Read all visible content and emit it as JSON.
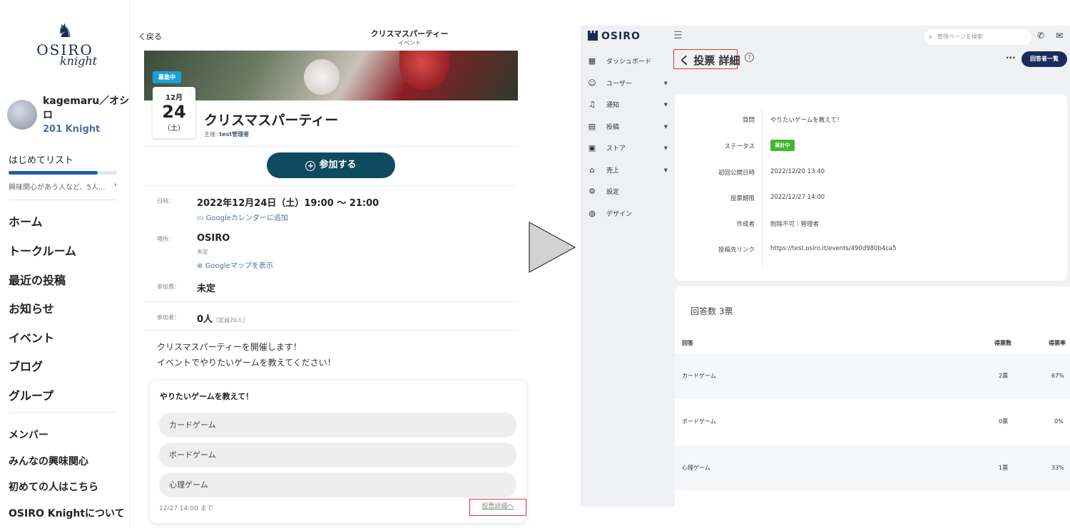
{
  "member_app": {
    "logo": {
      "main": "OSIRO",
      "sub": "knight"
    },
    "profile": {
      "name": "kagemaru／オシロ",
      "knight_level": "201 Knight"
    },
    "checklist": {
      "title": "はじめてリスト",
      "subtitle": "興味関心があう人など、5人...",
      "chevron": "›",
      "progress_percent": 82
    },
    "nav": [
      "ホーム",
      "トークルーム",
      "最近の投稿",
      "お知らせ",
      "イベント",
      "ブログ",
      "グループ"
    ],
    "sub_nav": [
      "メンバー",
      "みんなの興味関心",
      "初めての人はこちら",
      "OSIRO Knightについて"
    ],
    "event": {
      "back_label": "く戻る",
      "header_title": "クリスマスパーティー",
      "header_subtitle": "イベント",
      "recruiting_badge": "募集中",
      "date_month": "12月",
      "date_day": "24",
      "date_dow": "（土）",
      "title": "クリスマスパーティー",
      "host_label": "主催:",
      "host_name": "test管理者",
      "join_button": "参加する",
      "date_label": "日時：",
      "date_value": "2022年12月24日（土）19:00 ～ 21:00",
      "calendar_link": "Googleカレンダーに追加",
      "place_label": "場所：",
      "place_value": "OSIRO",
      "place_note": "未定",
      "map_link": "Googleマップを表示",
      "fee_label": "参加費：",
      "fee_value": "未定",
      "participants_label": "参加者：",
      "participants_value": "0人",
      "participants_capacity": "（定員20人）",
      "description_lines": [
        "クリスマスパーティーを開催します！",
        "イベントでやりたいゲームを教えてください！"
      ]
    },
    "poll": {
      "question": "やりたいゲームを教えて！",
      "options": [
        "カードゲーム",
        "ボードゲーム",
        "心理ゲーム"
      ],
      "deadline": "12/27 14:00 まで",
      "detail_link": "投票詳細へ"
    }
  },
  "admin_app": {
    "logo": "OSIRO",
    "search_placeholder": "管理ページを検索",
    "nav": [
      {
        "label": "ダッシュボード",
        "icon": "dashboard-icon",
        "glyph": "▦",
        "has_caret": false
      },
      {
        "label": "ユーザー",
        "icon": "user-face-icon",
        "glyph": "☺",
        "has_caret": true
      },
      {
        "label": "通知",
        "icon": "bell-icon",
        "glyph": "♫",
        "has_caret": true
      },
      {
        "label": "投稿",
        "icon": "document-icon",
        "glyph": "▤",
        "has_caret": true
      },
      {
        "label": "ストア",
        "icon": "store-icon",
        "glyph": "▣",
        "has_caret": true
      },
      {
        "label": "売上",
        "icon": "bank-icon",
        "glyph": "⌂",
        "has_caret": true
      },
      {
        "label": "設定",
        "icon": "gear-icon",
        "glyph": "⚙",
        "has_caret": false
      },
      {
        "label": "デザイン",
        "icon": "palette-icon",
        "glyph": "◍",
        "has_caret": false
      }
    ],
    "page_title": "く 投票 詳細",
    "respondents_button": "回答者一覧",
    "details": [
      {
        "label": "質問",
        "value": "やりたいゲームを教えて！"
      },
      {
        "label": "ステータス",
        "value": "集計中"
      },
      {
        "label": "初回公開日時",
        "value": "2022/12/20 13:40"
      },
      {
        "label": "投票期限",
        "value": "2022/12/27 14:00"
      },
      {
        "label": "作成者",
        "value": "削除不可｜管理者"
      },
      {
        "label": "投稿先リンク",
        "value": "https://test.osiro.it/events/490d980b4ca5"
      }
    ],
    "results": {
      "count_label": "回答数 3票",
      "headers": {
        "answer": "回答",
        "votes": "得票数",
        "rate": "得票率"
      },
      "rows": [
        {
          "answer": "カードゲーム",
          "votes": "2票",
          "rate": "67%"
        },
        {
          "answer": "ボードゲーム",
          "votes": "0票",
          "rate": "0%"
        },
        {
          "answer": "心理ゲーム",
          "votes": "1票",
          "rate": "33%"
        }
      ]
    }
  },
  "colors": {
    "primary_navy": "#1b2a5e",
    "join_button": "#0f4b5f",
    "badge_blue": "#1aa0d8",
    "status_green": "#3fb830",
    "highlight_red": "#e03a3a"
  }
}
